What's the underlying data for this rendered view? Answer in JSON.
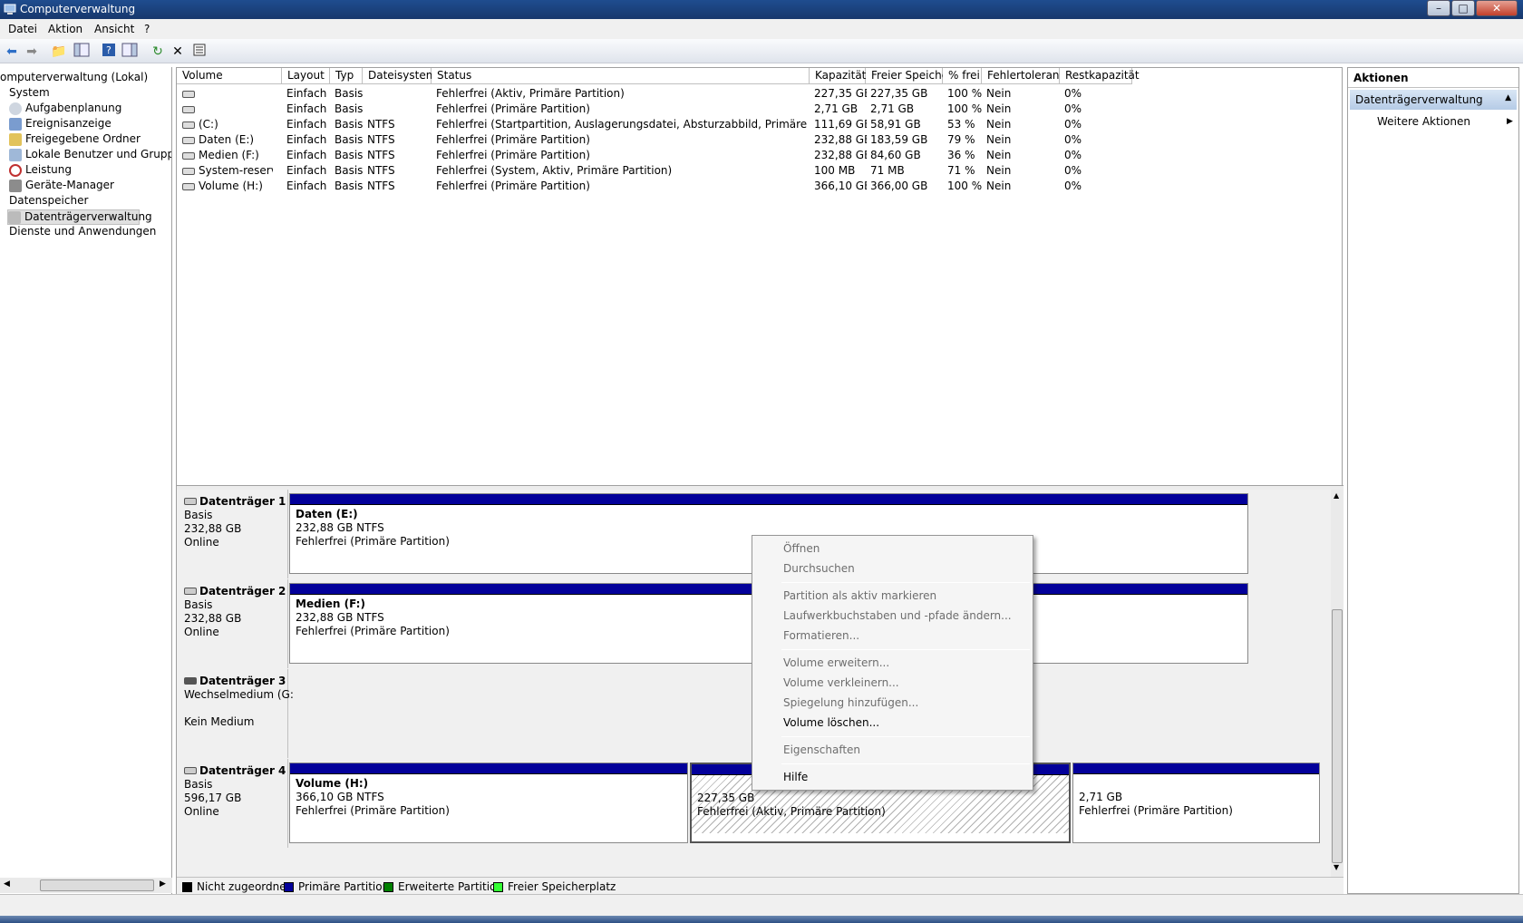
{
  "window": {
    "title": "Computerverwaltung"
  },
  "menu": [
    "Datei",
    "Aktion",
    "Ansicht",
    "?"
  ],
  "tree": {
    "root": "omputerverwaltung (Lokal)",
    "items": [
      "System",
      "Aufgabenplanung",
      "Ereignisanzeige",
      "Freigegebene Ordner",
      "Lokale Benutzer und Gruppen",
      "Leistung",
      "Geräte-Manager",
      "Datenspeicher",
      "Datenträgerverwaltung",
      "Dienste und Anwendungen"
    ]
  },
  "volume_list": {
    "columns": [
      "Volume",
      "Layout",
      "Typ",
      "Dateisystem",
      "Status",
      "Kapazität",
      "Freier Speicher",
      "% frei",
      "Fehlertoleranz",
      "Restkapazität"
    ],
    "rows": [
      [
        "",
        "Einfach",
        "Basis",
        "",
        "Fehlerfrei (Aktiv, Primäre Partition)",
        "227,35 GB",
        "227,35 GB",
        "100 %",
        "Nein",
        "0%"
      ],
      [
        "",
        "Einfach",
        "Basis",
        "",
        "Fehlerfrei (Primäre Partition)",
        "2,71 GB",
        "2,71 GB",
        "100 %",
        "Nein",
        "0%"
      ],
      [
        "(C:)",
        "Einfach",
        "Basis",
        "NTFS",
        "Fehlerfrei (Startpartition, Auslagerungsdatei, Absturzabbild, Primäre Partition)",
        "111,69 GB",
        "58,91 GB",
        "53 %",
        "Nein",
        "0%"
      ],
      [
        "Daten (E:)",
        "Einfach",
        "Basis",
        "NTFS",
        "Fehlerfrei (Primäre Partition)",
        "232,88 GB",
        "183,59 GB",
        "79 %",
        "Nein",
        "0%"
      ],
      [
        "Medien (F:)",
        "Einfach",
        "Basis",
        "NTFS",
        "Fehlerfrei (Primäre Partition)",
        "232,88 GB",
        "84,60 GB",
        "36 %",
        "Nein",
        "0%"
      ],
      [
        "System-reserviert",
        "Einfach",
        "Basis",
        "NTFS",
        "Fehlerfrei (System, Aktiv, Primäre Partition)",
        "100 MB",
        "71 MB",
        "71 %",
        "Nein",
        "0%"
      ],
      [
        "Volume (H:)",
        "Einfach",
        "Basis",
        "NTFS",
        "Fehlerfrei (Primäre Partition)",
        "366,10 GB",
        "366,00 GB",
        "100 %",
        "Nein",
        "0%"
      ]
    ]
  },
  "disks": [
    {
      "name": "Datenträger 1",
      "type": "Basis",
      "size": "232,88 GB",
      "state": "Online",
      "partition": {
        "name": "Daten  (E:)",
        "fs": "232,88 GB NTFS",
        "status": "Fehlerfrei (Primäre Partition)"
      }
    },
    {
      "name": "Datenträger 2",
      "type": "Basis",
      "size": "232,88 GB",
      "state": "Online",
      "partition": {
        "name": "Medien  (F:)",
        "fs": "232,88 GB NTFS",
        "status": "Fehlerfrei (Primäre Partition)"
      }
    },
    {
      "name": "Datenträger 3",
      "type": "Wechselmedium (G:",
      "state": "Kein Medium"
    },
    {
      "name": "Datenträger 4",
      "type": "Basis",
      "size": "596,17 GB",
      "state": "Online",
      "partitions": [
        {
          "name": "Volume  (H:)",
          "fs": "366,10 GB NTFS",
          "status": "Fehlerfrei (Primäre Partition)"
        },
        {
          "fs": "227,35 GB",
          "status": "Fehlerfrei (Aktiv, Primäre Partition)"
        },
        {
          "fs": "2,71 GB",
          "status": "Fehlerfrei (Primäre Partition)"
        }
      ]
    }
  ],
  "legend": [
    {
      "label": "Nicht zugeordnet",
      "color": "#000000"
    },
    {
      "label": "Primäre Partition",
      "color": "#03009a"
    },
    {
      "label": "Erweiterte Partition",
      "color": "#008000"
    },
    {
      "label": "Freier Speicherplatz",
      "color": "#33ff33"
    }
  ],
  "actions": {
    "header": "Aktionen",
    "section": "Datenträgerverwaltung",
    "more": "Weitere Aktionen"
  },
  "context_menu": [
    {
      "label": "Öffnen",
      "enabled": false
    },
    {
      "label": "Durchsuchen",
      "enabled": false
    },
    {
      "label": "Partition als aktiv markieren",
      "enabled": false
    },
    {
      "label": "Laufwerkbuchstaben und -pfade ändern...",
      "enabled": false
    },
    {
      "label": "Formatieren...",
      "enabled": false
    },
    {
      "label": "Volume erweitern...",
      "enabled": false
    },
    {
      "label": "Volume verkleinern...",
      "enabled": false
    },
    {
      "label": "Spiegelung hinzufügen...",
      "enabled": false
    },
    {
      "label": "Volume löschen...",
      "enabled": true
    },
    {
      "label": "Eigenschaften",
      "enabled": false
    },
    {
      "label": "Hilfe",
      "enabled": true
    }
  ]
}
